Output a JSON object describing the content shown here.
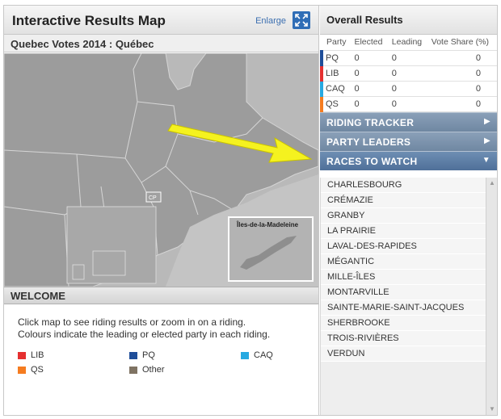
{
  "map_panel": {
    "title": "Interactive Results Map",
    "enlarge_label": "Enlarge",
    "subtitle": "Quebec Votes 2014 : Québec",
    "inset_label": "Îles-de-la-Madeleine",
    "map_marker_label": "CP"
  },
  "welcome": {
    "heading": "WELCOME",
    "line1": "Click map to see riding results or zoom in on a riding.",
    "line2": "Colours indicate the leading or elected party in each riding."
  },
  "legend": [
    {
      "label": "LIB",
      "color": "#e53030"
    },
    {
      "label": "PQ",
      "color": "#1f4e99"
    },
    {
      "label": "CAQ",
      "color": "#27a9e1"
    },
    {
      "label": "QS",
      "color": "#f57c20"
    },
    {
      "label": "Other",
      "color": "#7f7363"
    }
  ],
  "results": {
    "heading": "Overall Results",
    "columns": [
      "Party",
      "Elected",
      "Leading",
      "Vote Share (%)"
    ],
    "rows": [
      {
        "party": "PQ",
        "elected": "0",
        "leading": "0",
        "share": "0",
        "color": "#1f4e99"
      },
      {
        "party": "LIB",
        "elected": "0",
        "leading": "0",
        "share": "0",
        "color": "#e53030"
      },
      {
        "party": "CAQ",
        "elected": "0",
        "leading": "0",
        "share": "0",
        "color": "#27a9e1"
      },
      {
        "party": "QS",
        "elected": "0",
        "leading": "0",
        "share": "0",
        "color": "#f57c20"
      }
    ]
  },
  "sections": {
    "riding_tracker": "RIDING TRACKER",
    "party_leaders": "PARTY LEADERS",
    "races_to_watch": "RACES TO WATCH"
  },
  "races": [
    "CHARLESBOURG",
    "CRÉMAZIE",
    "GRANBY",
    "LA PRAIRIE",
    "LAVAL-DES-RAPIDES",
    "MÉGANTIC",
    "MILLE-ÎLES",
    "MONTARVILLE",
    "SAINTE-MARIE-SAINT-JACQUES",
    "SHERBROOKE",
    "TROIS-RIVIÈRES",
    "VERDUN"
  ],
  "icons": {
    "enlarge": "expand-arrows-icon",
    "collapsed": "triangle-right-icon",
    "expanded": "triangle-down-icon",
    "annotation": "yellow-arrow"
  }
}
